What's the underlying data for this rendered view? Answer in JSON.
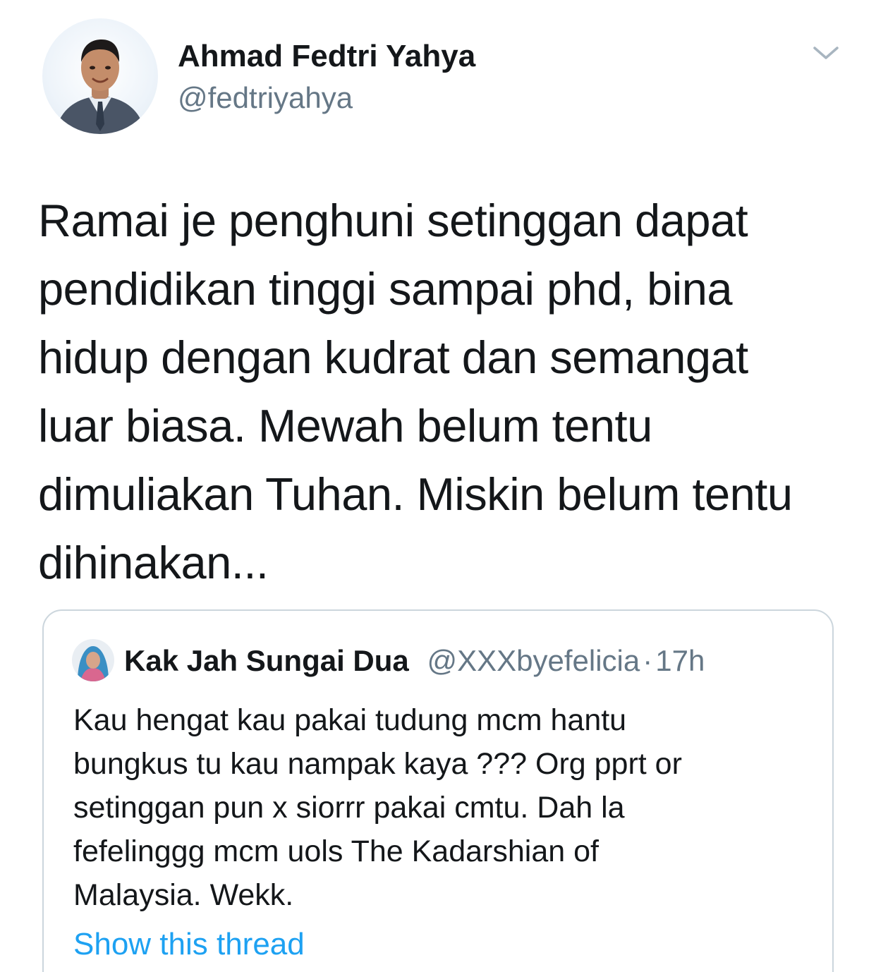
{
  "tweet": {
    "author": {
      "display_name": "Ahmad Fedtri Yahya",
      "handle": "@fedtriyahya",
      "avatar_icon": "profile-photo"
    },
    "menu_icon": "chevron-down-icon",
    "text": "Ramai je penghuni setinggan dapat\npendidikan tinggi sampai phd, bina\nhidup dengan kudrat dan semangat\nluar biasa. Mewah belum tentu\ndimuliakan Tuhan. Miskin belum tentu\ndihinakan..."
  },
  "quoted_tweet": {
    "display_name": "Kak Jah Sungai Dua",
    "handle": "@XXXbyefelicia",
    "separator": "·",
    "time": "17h",
    "text": "Kau hengat kau pakai tudung mcm hantu\nbungkus tu kau nampak kaya ??? Org pprt or\nsetinggan pun x siorrr pakai cmtu. Dah la\nfefelinggg mcm uols The Kadarshian of\nMalaysia. Wekk.",
    "show_thread_label": "Show this thread"
  },
  "colors": {
    "text_primary": "#14171a",
    "text_secondary": "#657786",
    "link": "#1da1f2",
    "border": "#ccd6dd",
    "background": "#ffffff"
  }
}
